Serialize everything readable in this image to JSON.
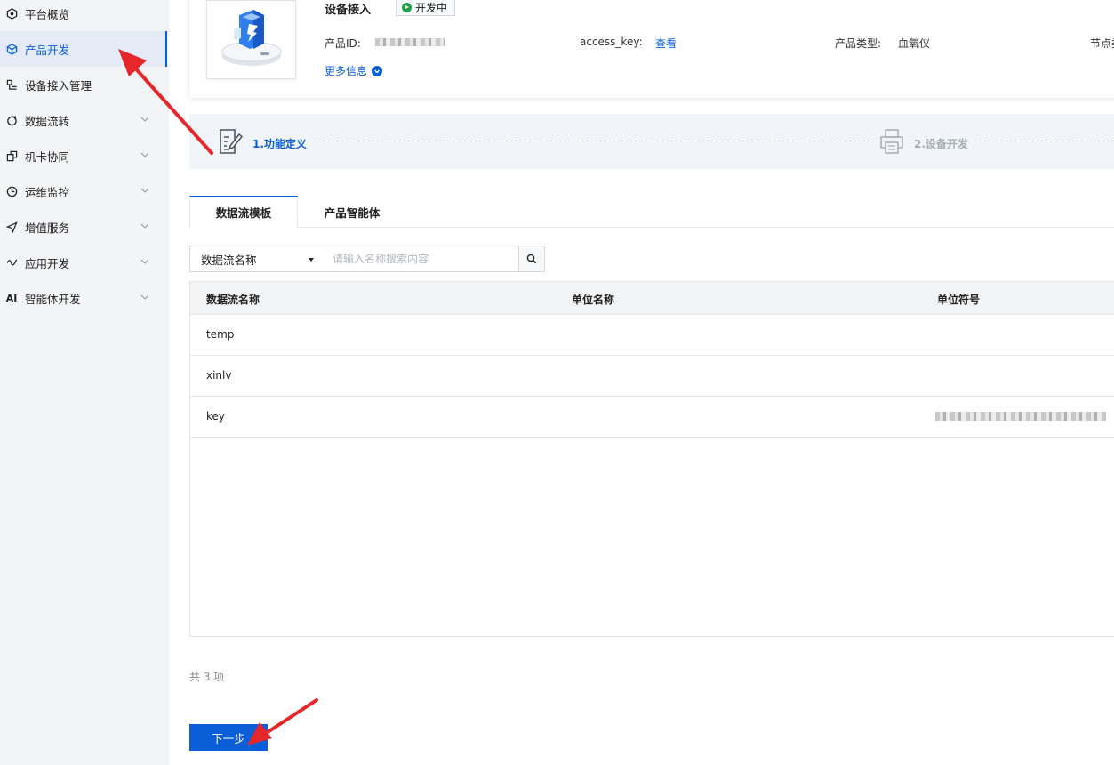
{
  "sidebar": {
    "items": [
      {
        "label": "平台概览",
        "icon": "gauge-icon",
        "expandable": false
      },
      {
        "label": "产品开发",
        "icon": "cube-icon",
        "expandable": false,
        "active": true
      },
      {
        "label": "设备接入管理",
        "icon": "device-icon",
        "expandable": false
      },
      {
        "label": "数据流转",
        "icon": "flow-icon",
        "expandable": true
      },
      {
        "label": "机卡协同",
        "icon": "sim-icon",
        "expandable": true
      },
      {
        "label": "运维监控",
        "icon": "monitor-icon",
        "expandable": true
      },
      {
        "label": "增值服务",
        "icon": "send-icon",
        "expandable": true
      },
      {
        "label": "应用开发",
        "icon": "app-icon",
        "expandable": true
      },
      {
        "label": "智能体开发",
        "icon": "ai-icon",
        "icon_text": "AI",
        "expandable": true
      }
    ]
  },
  "product": {
    "name": "设备接入",
    "status": "开发中",
    "product_id_label": "产品ID:",
    "access_key_label": "access_key:",
    "access_key_link": "查看",
    "type_label": "产品类型:",
    "type_value": "血氧仪",
    "node_label": "节点类",
    "more_info": "更多信息"
  },
  "steps": [
    {
      "label": "1.功能定义",
      "state": "active"
    },
    {
      "label": "2.设备开发",
      "state": "inactive"
    }
  ],
  "tabs": [
    {
      "label": "数据流模板",
      "active": true
    },
    {
      "label": "产品智能体",
      "active": false
    }
  ],
  "search": {
    "select_value": "数据流名称",
    "placeholder": "请输入名称搜索内容"
  },
  "table": {
    "columns": [
      "数据流名称",
      "单位名称",
      "单位符号"
    ],
    "rows": [
      {
        "name": "temp",
        "unit_name": "",
        "unit_symbol": ""
      },
      {
        "name": "xinlv",
        "unit_name": "",
        "unit_symbol": ""
      },
      {
        "name": "key",
        "unit_name": "",
        "unit_symbol": "redacted"
      }
    ]
  },
  "footer": {
    "total": "共 3 项",
    "next_button": "下一步"
  },
  "colors": {
    "accent": "#0a5fd8",
    "status_green": "#1aa14a",
    "annotation_red": "#e5262a"
  }
}
